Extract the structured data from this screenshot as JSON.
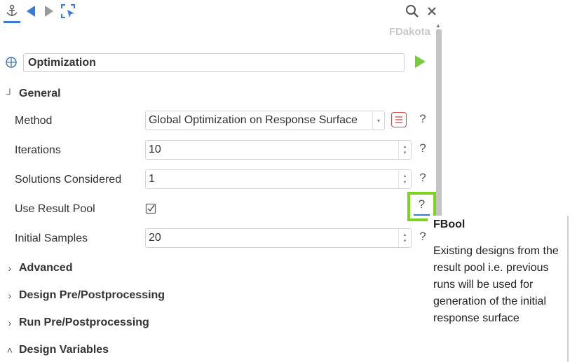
{
  "panel": {
    "title": "FDakota",
    "name_value": "Optimization"
  },
  "icons": {
    "anchor": "anchor-icon",
    "back": "back-arrow-icon",
    "forward": "forward-arrow-icon",
    "select": "select-cursor-icon",
    "search": "search-icon",
    "close": "close-icon",
    "crosshair": "crosshair-icon",
    "run": "run-icon",
    "list": "list-icon",
    "checkbox": "checkbox-icon"
  },
  "sections": {
    "general": "General",
    "advanced": "Advanced",
    "design_pre_post": "Design Pre/Postprocessing",
    "run_pre_post": "Run Pre/Postprocessing",
    "design_variables": "Design Variables"
  },
  "rows": {
    "method": {
      "label": "Method",
      "value": "Global Optimization on Response Surface"
    },
    "iterations": {
      "label": "Iterations",
      "value": "10"
    },
    "solutions": {
      "label": "Solutions Considered",
      "value": "1"
    },
    "use_result_pool": {
      "label": "Use Result Pool",
      "checked": true
    },
    "initial_samples": {
      "label": "Initial Samples",
      "value": "20"
    }
  },
  "help_label": "?",
  "tooltip": {
    "title": "FBool",
    "body": "Existing designs from the result pool i.e. previous runs will be used for generation of the initial response surface"
  },
  "colors": {
    "accent_blue": "#3a7bd5",
    "highlight_green": "#7ed321",
    "run_green": "#7ac943",
    "list_red": "#d04848"
  }
}
